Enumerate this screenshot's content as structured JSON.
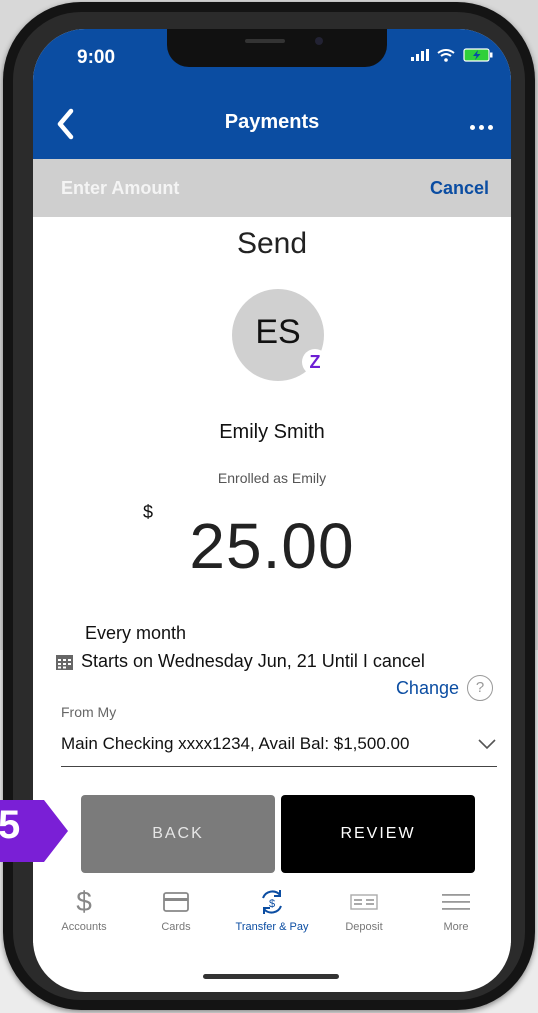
{
  "status_bar": {
    "time": "9:00"
  },
  "header": {
    "title": "Payments"
  },
  "subheader": {
    "left": "Enter Amount",
    "cancel": "Cancel"
  },
  "send": {
    "title": "Send",
    "initials": "ES",
    "zelle_glyph": "Z",
    "name": "Emily Smith",
    "enrolled": "Enrolled as Emily",
    "currency": "$",
    "amount": "25.00"
  },
  "schedule": {
    "frequency": "Every month",
    "starts": "Starts on Wednesday Jun, 21 Until I cancel",
    "change": "Change",
    "help": "?"
  },
  "from": {
    "label": "From My",
    "account": "Main Checking xxxx1234, Avail Bal: $1,500.00"
  },
  "buttons": {
    "back": "BACK",
    "review": "REVIEW"
  },
  "tabs": [
    {
      "label": "Accounts",
      "icon": "dollar-icon"
    },
    {
      "label": "Cards",
      "icon": "card-icon"
    },
    {
      "label": "Transfer & Pay",
      "icon": "transfer-icon",
      "active": true
    },
    {
      "label": "Deposit",
      "icon": "check-deposit-icon"
    },
    {
      "label": "More",
      "icon": "menu-icon"
    }
  ],
  "annotation": {
    "step": "5"
  },
  "colors": {
    "brand_blue": "#0b4da2",
    "zelle_purple": "#6d1ed4",
    "step_badge_purple": "#7a1fd6"
  }
}
